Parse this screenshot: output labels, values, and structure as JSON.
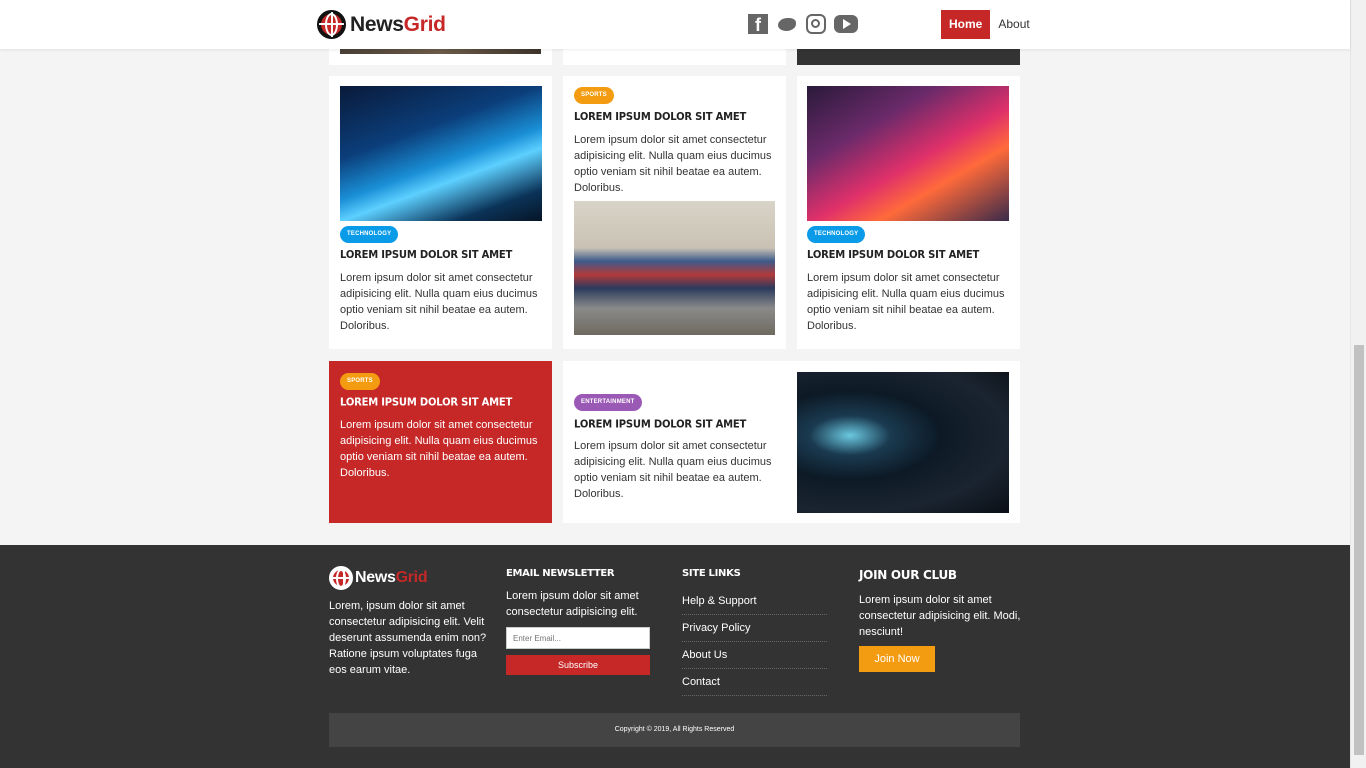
{
  "brand": {
    "part1": "News",
    "part2": "Grid"
  },
  "nav": {
    "home": "Home",
    "about": "About"
  },
  "social": [
    "facebook-icon",
    "twitter-icon",
    "instagram-icon",
    "youtube-icon"
  ],
  "colors": {
    "accent": "#c62828",
    "technology": "#0a9be8",
    "sports": "#f39c12",
    "entertainment": "#9b59b6",
    "footer": "#333333"
  },
  "cards": [
    {
      "category": "Technology",
      "title": "Lorem ipsum dolor sit amet",
      "text": "Lorem ipsum dolor sit amet consectetur adipisicing elit. Nulla quam eius ducimus optio veniam sit nihil beatae ea autem. Doloribus."
    },
    {
      "category": "Sports",
      "title": "Lorem ipsum dolor sit amet",
      "text": "Lorem ipsum dolor sit amet consectetur adipisicing elit. Nulla quam eius ducimus optio veniam sit nihil beatae ea autem. Doloribus."
    },
    {
      "category": "Technology",
      "title": "Lorem ipsum dolor sit amet",
      "text": "Lorem ipsum dolor sit amet consectetur adipisicing elit. Nulla quam eius ducimus optio veniam sit nihil beatae ea autem. Doloribus."
    },
    {
      "category": "Sports",
      "title": "Lorem ipsum dolor sit amet",
      "text": "Lorem ipsum dolor sit amet consectetur adipisicing elit. Nulla quam eius ducimus optio veniam sit nihil beatae ea autem. Doloribus."
    },
    {
      "category": "Entertainment",
      "title": "Lorem ipsum dolor sit amet",
      "text": "Lorem ipsum dolor sit amet consectetur adipisicing elit. Nulla quam eius ducimus optio veniam sit nihil beatae ea autem. Doloribus."
    }
  ],
  "footer": {
    "about_text": "Lorem, ipsum dolor sit amet consectetur adipisicing elit. Velit deserunt assumenda enim non? Ratione ipsum voluptates fuga eos earum vitae.",
    "newsletter": {
      "heading": "Email Newsletter",
      "text": "Lorem ipsum dolor sit amet consectetur adipisicing elit.",
      "placeholder": "Enter Email...",
      "button": "Subscribe"
    },
    "sitelinks": {
      "heading": "Site Links",
      "items": [
        "Help & Support",
        "Privacy Policy",
        "About Us",
        "Contact"
      ]
    },
    "club": {
      "heading": "Join Our Club",
      "text": "Lorem ipsum dolor sit amet consectetur adipisicing elit. Modi, nesciunt!",
      "button": "Join Now"
    },
    "copyright": "Copyright © 2019, All Rights Reserved"
  }
}
